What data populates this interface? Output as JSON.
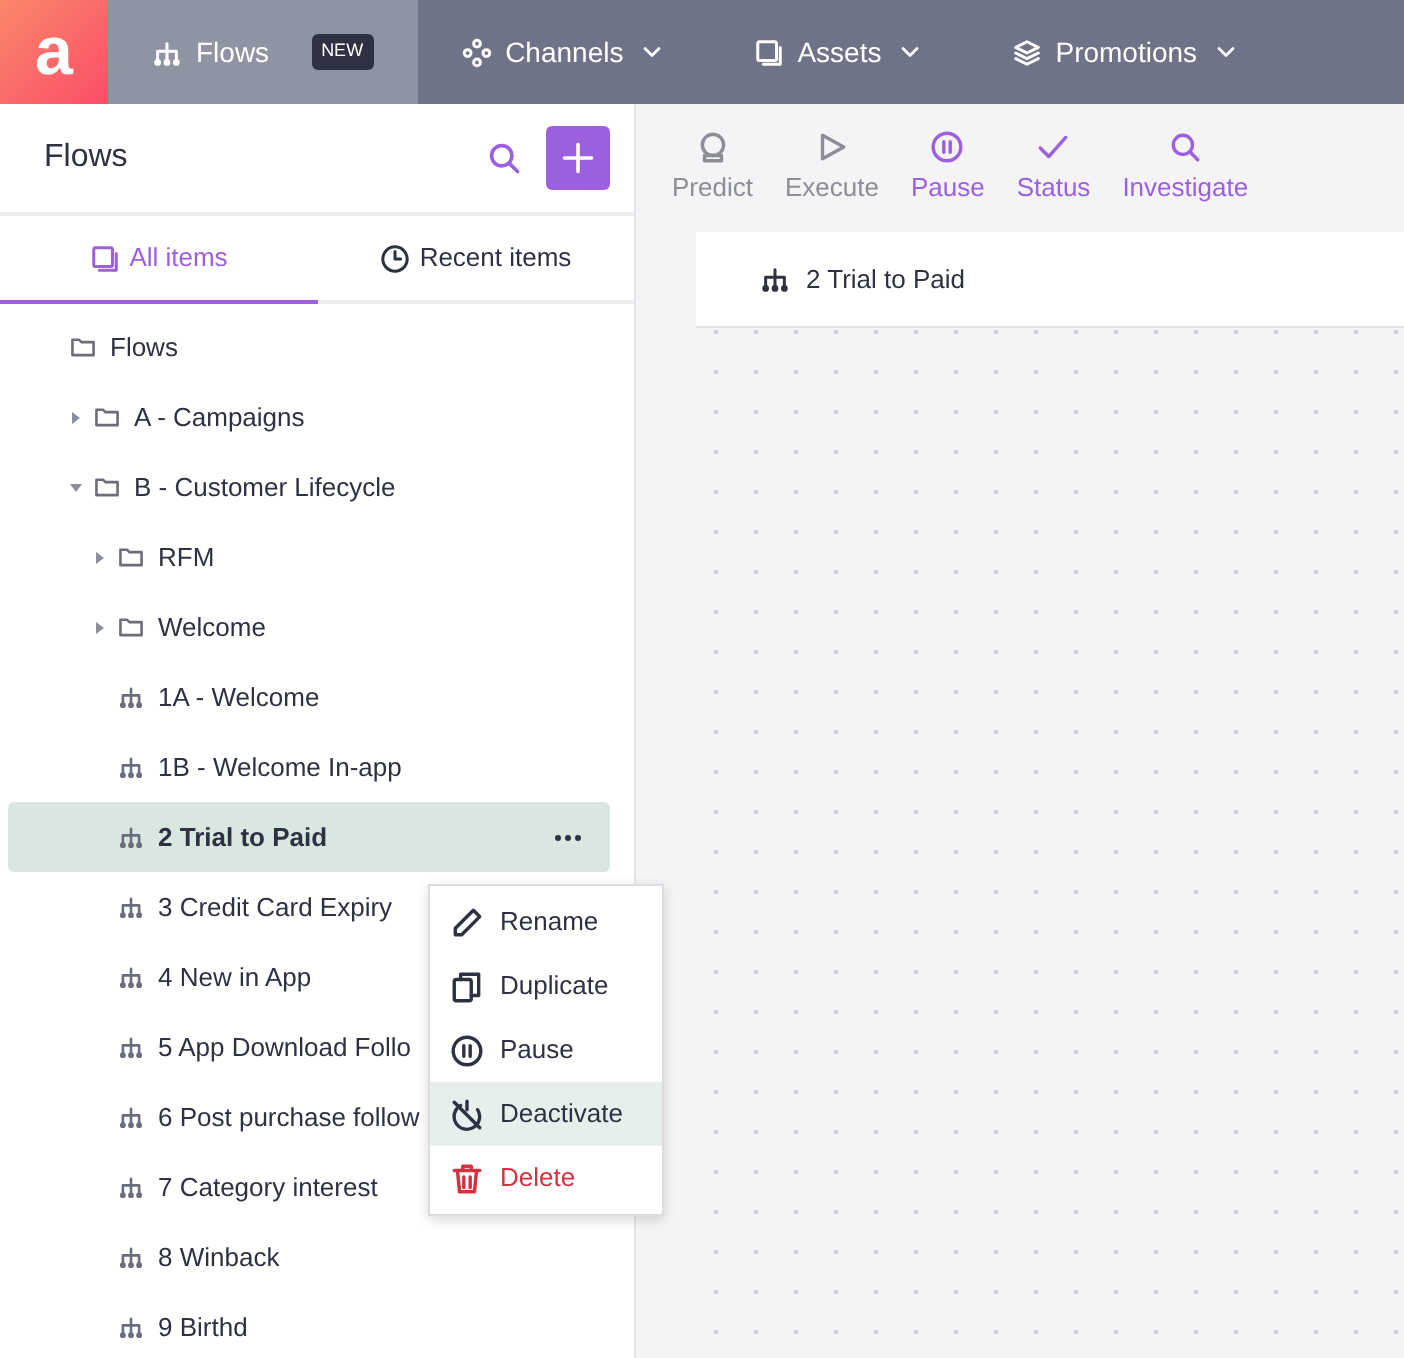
{
  "topnav": {
    "logo": "a",
    "items": [
      {
        "label": "Flows",
        "badge": "NEW",
        "selected": true,
        "dropdown": false
      },
      {
        "label": "Channels",
        "selected": false,
        "dropdown": true
      },
      {
        "label": "Assets",
        "selected": false,
        "dropdown": true
      },
      {
        "label": "Promotions",
        "selected": false,
        "dropdown": true
      }
    ]
  },
  "sidebar": {
    "title": "Flows",
    "tabs": [
      {
        "label": "All items",
        "selected": true
      },
      {
        "label": "Recent items",
        "selected": false
      }
    ],
    "tree": [
      {
        "label": "Flows",
        "kind": "folder",
        "children": [
          {
            "label": "A - Campaigns",
            "kind": "folder",
            "expanded": false
          },
          {
            "label": "B - Customer Lifecycle",
            "kind": "folder",
            "expanded": true,
            "children": [
              {
                "label": "RFM",
                "kind": "folder",
                "expanded": false
              },
              {
                "label": "Welcome",
                "kind": "folder",
                "expanded": false
              },
              {
                "label": "1A - Welcome",
                "kind": "flow",
                "selected": false
              },
              {
                "label": "1B - Welcome In-app",
                "kind": "flow",
                "selected": false
              },
              {
                "label": "2 Trial to Paid",
                "kind": "flow",
                "selected": true
              },
              {
                "label": "3 Credit Card Expiry",
                "kind": "flow",
                "selected": false
              },
              {
                "label": "4 New in App",
                "kind": "flow",
                "selected": false
              },
              {
                "label": "5 App Download Follo",
                "kind": "flow",
                "selected": false
              },
              {
                "label": "6 Post purchase follow",
                "kind": "flow",
                "selected": false
              },
              {
                "label": "7 Category interest",
                "kind": "flow",
                "selected": false
              },
              {
                "label": "8 Winback",
                "kind": "flow",
                "selected": false
              },
              {
                "label": "9 Birthd",
                "kind": "flow",
                "selected": false
              }
            ]
          }
        ]
      }
    ],
    "context_menu": [
      {
        "label": "Rename",
        "kind": "normal",
        "selected": false
      },
      {
        "label": "Duplicate",
        "kind": "normal",
        "selected": false
      },
      {
        "label": "Pause",
        "kind": "normal",
        "selected": false
      },
      {
        "label": "Deactivate",
        "kind": "normal",
        "selected": true
      },
      {
        "label": "Delete",
        "kind": "danger",
        "selected": false
      }
    ]
  },
  "toolbar": [
    {
      "label": "Predict",
      "disabled": true
    },
    {
      "label": "Execute",
      "disabled": true
    },
    {
      "label": "Pause",
      "disabled": false
    },
    {
      "label": "Status",
      "disabled": false
    },
    {
      "label": "Investigate",
      "disabled": false
    }
  ],
  "canvas": {
    "title": "2 Trial to Paid"
  }
}
